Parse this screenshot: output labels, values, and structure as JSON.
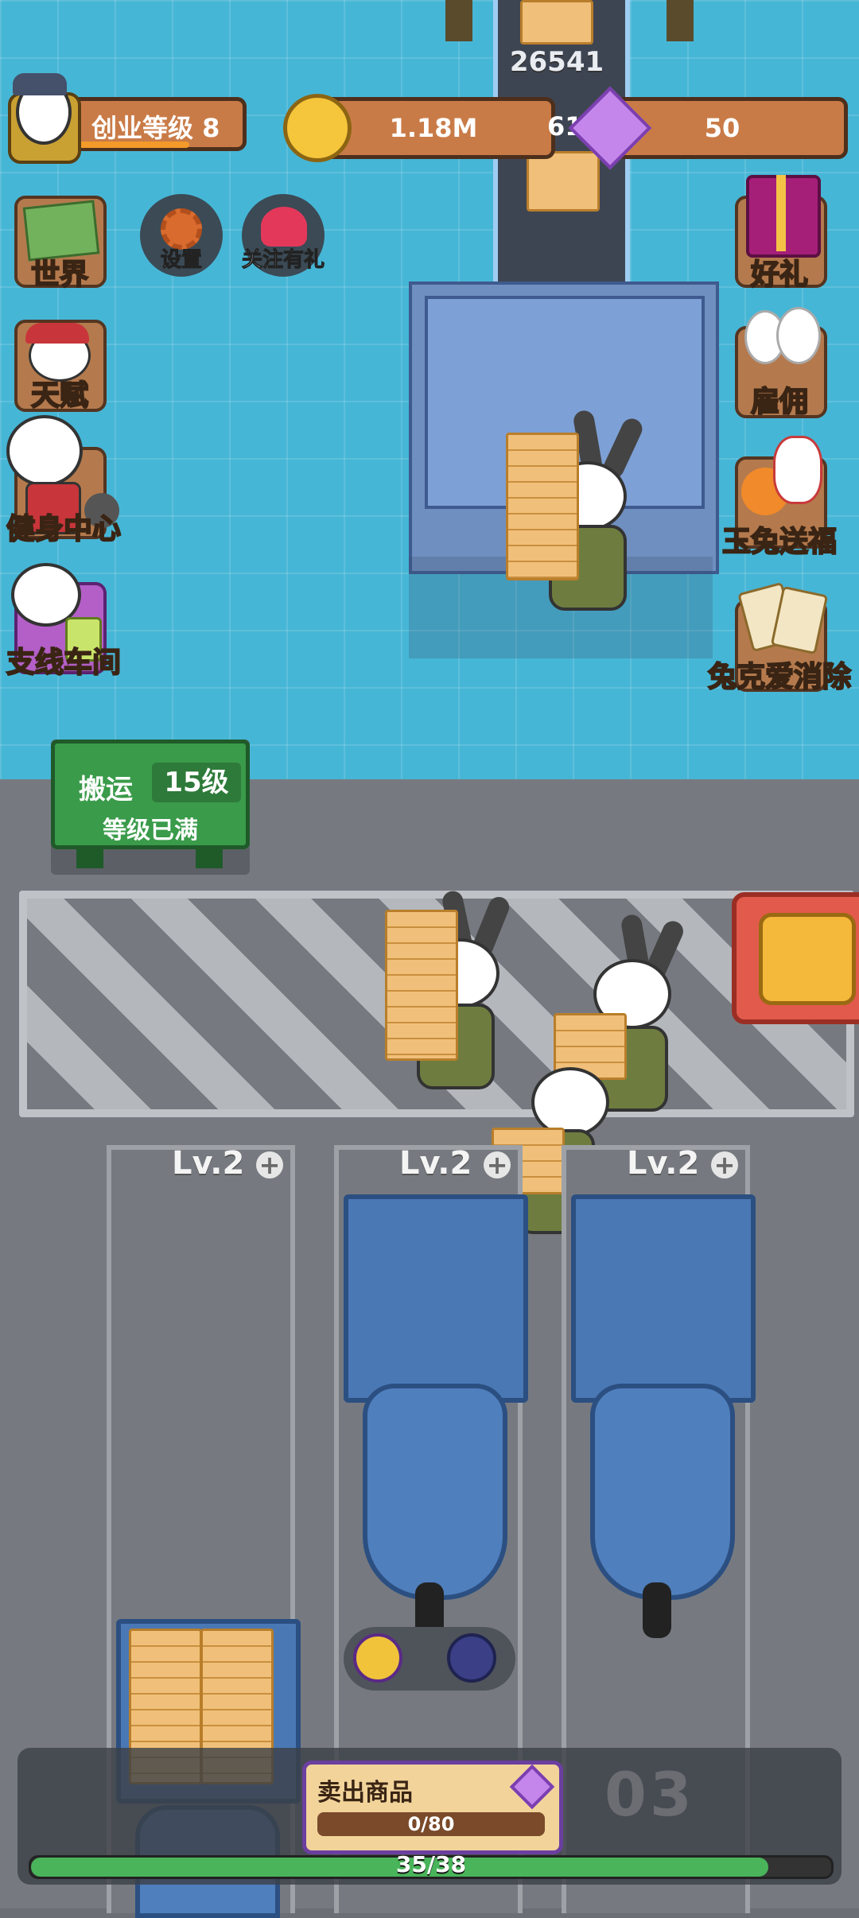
{
  "hud": {
    "level_label": "创业等级 8",
    "coins": "1.18M",
    "gems": "50",
    "conveyor_count": "26541",
    "conveyor_partial": "612"
  },
  "left_menu": [
    {
      "label": "世界",
      "icon": "world-map-icon"
    },
    {
      "label": "天赋",
      "icon": "talent-bunny-icon"
    },
    {
      "label": "健身中心",
      "icon": "gym-bunny-icon"
    },
    {
      "label": "支线车间",
      "icon": "side-workshop-icon"
    }
  ],
  "top_round_buttons": [
    {
      "label": "设置",
      "icon": "gear-icon"
    },
    {
      "label": "关注有礼",
      "icon": "heart-gift-icon"
    }
  ],
  "right_menu": [
    {
      "label": "好礼",
      "icon": "gift-box-icon"
    },
    {
      "label": "雇佣",
      "icon": "hire-bunnies-icon"
    },
    {
      "label": "玉兔送福",
      "icon": "jade-rabbit-icon"
    },
    {
      "label": "兔克爱消除",
      "icon": "tile-match-icon"
    }
  ],
  "transport_sign": {
    "title": "搬运",
    "level": "15级",
    "status": "等级已满"
  },
  "lanes": [
    {
      "level": "Lv.2"
    },
    {
      "level": "Lv.2"
    },
    {
      "level": "Lv.2"
    }
  ],
  "sell": {
    "label": "卖出商品",
    "progress_text": "0/80",
    "progress_value": 0
  },
  "station_number": "03",
  "xp": {
    "text": "35/38",
    "fraction": 0.921
  },
  "colors": {
    "floor_top": "#46b6d6",
    "floor_bottom": "#767a80",
    "sign_green": "#3a9b4a",
    "progress_green": "#49b45a"
  }
}
